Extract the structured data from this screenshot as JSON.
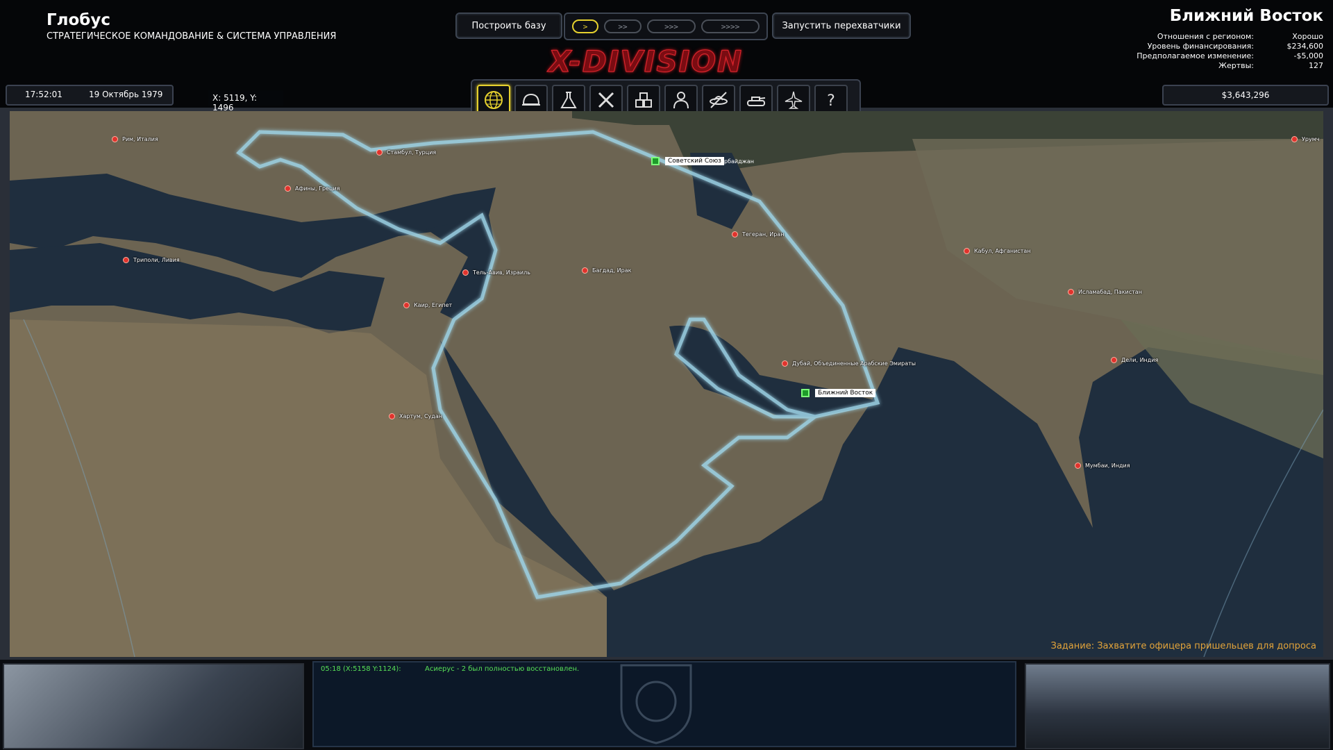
{
  "header": {
    "title": "Глобус",
    "subtitle": "СТРАТЕГИЧЕСКОЕ КОМАНДОВАНИЕ & СИСТЕМА УПРАВЛЕНИЯ",
    "build_base": "Построить базу",
    "launch_interceptors": "Запустить перехватчики",
    "logo": "X-DIVISION",
    "speeds": [
      ">",
      ">>",
      ">>>",
      ">>>>"
    ],
    "active_speed_index": 0
  },
  "region": {
    "name": "Ближний Восток",
    "stats": [
      {
        "label": "Отношения с регионом:",
        "value": "Хорошо"
      },
      {
        "label": "Уровень финансирования:",
        "value": "$234,600"
      },
      {
        "label": "Предполагаемое изменение:",
        "value": "-$5,000"
      },
      {
        "label": "Жертвы:",
        "value": "127"
      }
    ]
  },
  "status": {
    "time": "17:52:01",
    "date": "19 Октябрь 1979",
    "coords": "X: 5119, Y: 1496",
    "funds": "$3,643,296"
  },
  "toolbar": [
    "globe-icon",
    "helmet-icon",
    "flask-icon",
    "crossed-tools-icon",
    "crates-icon",
    "personnel-icon",
    "ufo-icon",
    "tank-icon",
    "aircraft-icon",
    "help-icon"
  ],
  "map": {
    "cities": [
      "Рим, Италия",
      "Стамбул, Турция",
      "Афины, Греция",
      "Триполи, Ливия",
      "Тель-Авив, Израиль",
      "Багдад, Ирак",
      "Тегеран, Иран",
      "Кабул, Афганистан",
      "Исламабад, Пакистан",
      "Каир, Египет",
      "Дубай, Объединенные Арабские Эмираты",
      "Дели, Индия",
      "Хартум, Судан",
      "Мумбаи, Индия",
      "Урумч"
    ],
    "bases": [
      {
        "label": "Советский Союз"
      },
      {
        "label": "Ближний Восток"
      }
    ],
    "partial_label": "рбайджан",
    "mission": "Задание: Захватите офицера пришельцев для допроса"
  },
  "log": {
    "time": "05:18 (X:5158 Y:1124):",
    "message": "Асиерус - 2 был полностью восстановлен."
  },
  "colors": {
    "accent": "#e6d12e",
    "border_glow": "#9fd6ea",
    "city_dot": "#e0332d",
    "base": "#1e9b2a"
  }
}
